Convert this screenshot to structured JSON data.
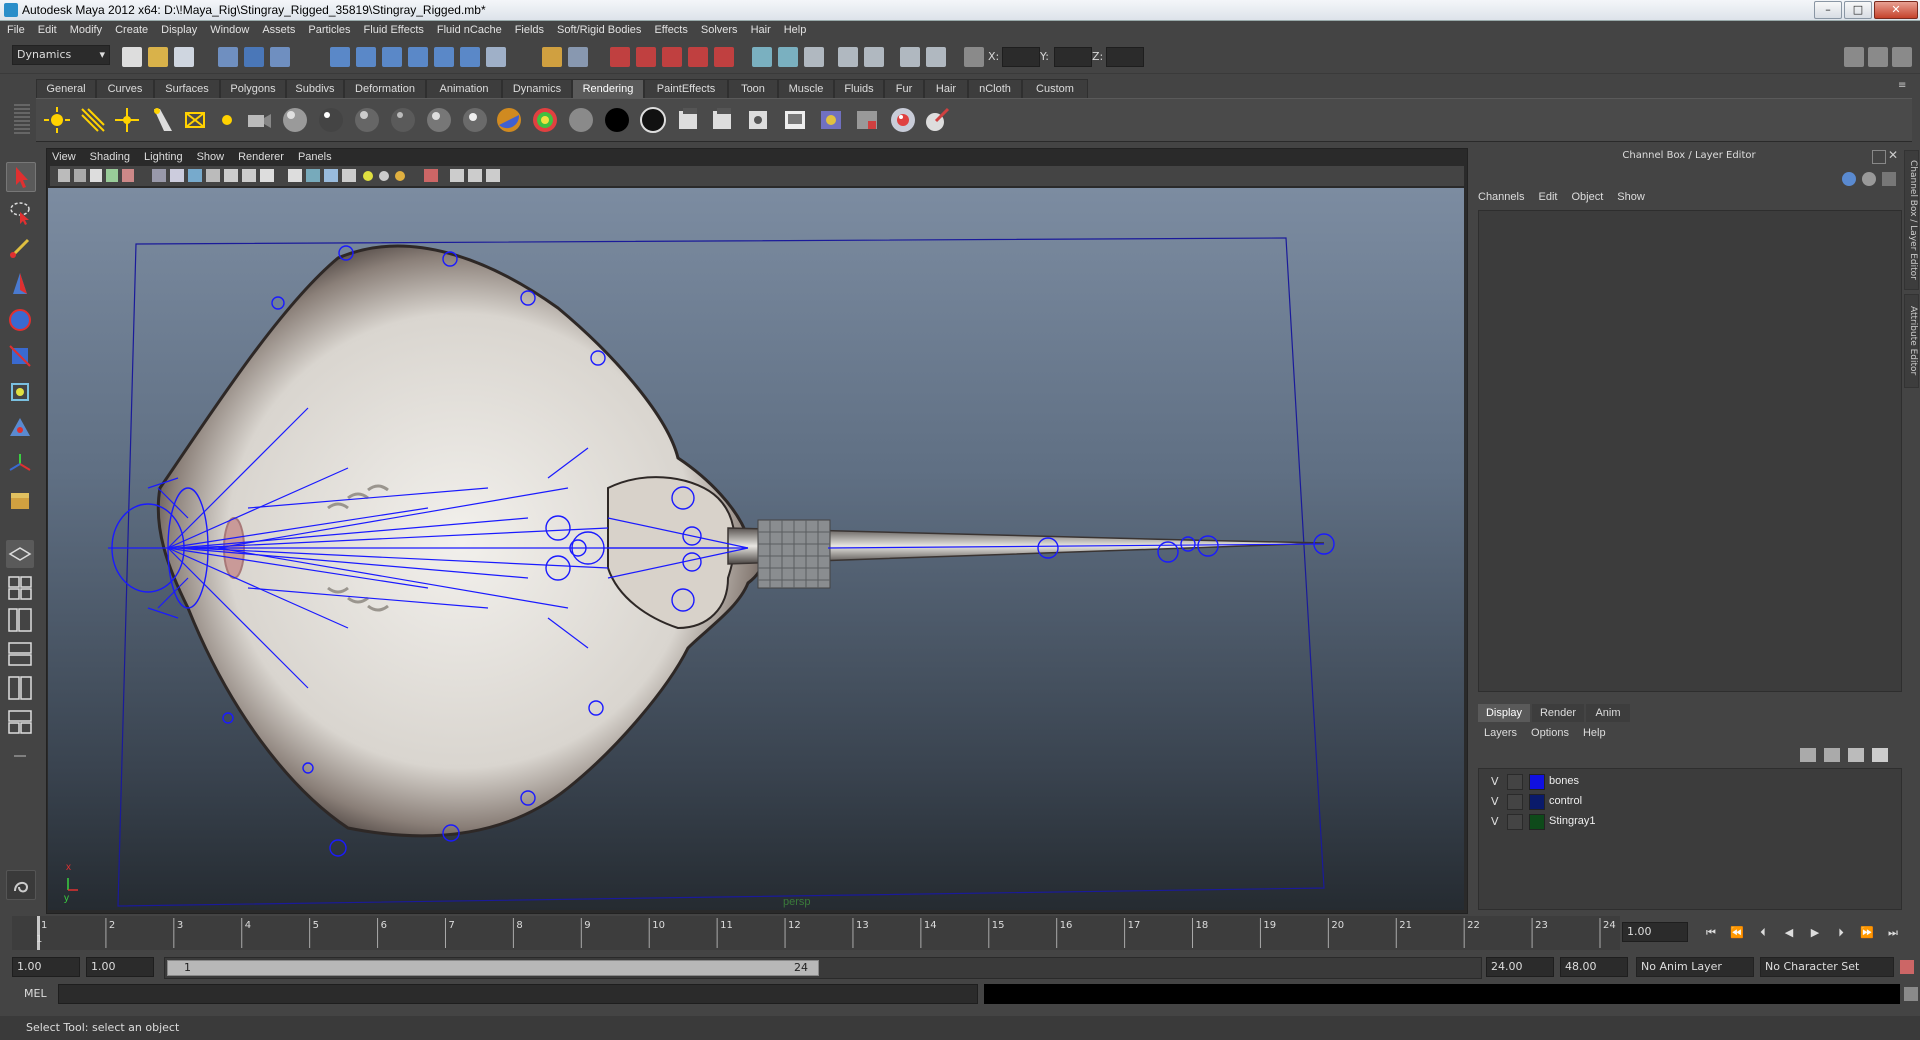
{
  "window": {
    "title": "Autodesk Maya 2012 x64: D:\\!Maya_Rig\\Stingray_Rigged_35819\\Stingray_Rigged.mb*",
    "min_label": "–",
    "max_label": "□",
    "close_label": "✕"
  },
  "menubar": [
    "File",
    "Edit",
    "Modify",
    "Create",
    "Display",
    "Window",
    "Assets",
    "Particles",
    "Fluid Effects",
    "Fluid nCache",
    "Fields",
    "Soft/Rigid Bodies",
    "Effects",
    "Solvers",
    "Hair",
    "Help"
  ],
  "statusline": {
    "mode": "Dynamics",
    "x_label": "X:",
    "y_label": "Y:",
    "z_label": "Z:"
  },
  "shelf_tabs": [
    "General",
    "Curves",
    "Surfaces",
    "Polygons",
    "Subdivs",
    "Deformation",
    "Animation",
    "Dynamics",
    "Rendering",
    "PaintEffects",
    "Toon",
    "Muscle",
    "Fluids",
    "Fur",
    "Hair",
    "nCloth",
    "Custom"
  ],
  "shelf_active": "Rendering",
  "viewport": {
    "menu": [
      "View",
      "Shading",
      "Lighting",
      "Show",
      "Renderer",
      "Panels"
    ],
    "camera_label": "persp",
    "axis_x": "x",
    "axis_y": "y"
  },
  "channel_box": {
    "title": "Channel Box / Layer Editor",
    "menu": [
      "Channels",
      "Edit",
      "Object",
      "Show"
    ]
  },
  "layer_editor": {
    "tabs": [
      "Display",
      "Render",
      "Anim"
    ],
    "active_tab": "Display",
    "menu": [
      "Layers",
      "Options",
      "Help"
    ],
    "layers": [
      {
        "visible": "V",
        "name": "bones",
        "color": "#1010e0"
      },
      {
        "visible": "V",
        "name": "control",
        "color": "#0a1a6a"
      },
      {
        "visible": "V",
        "name": "Stingray1",
        "color": "#0e4a1a"
      }
    ]
  },
  "side_tabs": [
    "Channel Box / Layer Editor",
    "Attribute Editor"
  ],
  "timeline": {
    "ticks": [
      "1",
      "2",
      "3",
      "4",
      "5",
      "6",
      "7",
      "8",
      "9",
      "10",
      "11",
      "12",
      "13",
      "14",
      "15",
      "16",
      "17",
      "18",
      "19",
      "20",
      "21",
      "22",
      "23",
      "24"
    ],
    "current_frame_marker": "1",
    "current_frame": "1.00"
  },
  "range": {
    "start_time": "1.00",
    "playback_start": "1.00",
    "range_start_label": "1",
    "range_end_label": "24",
    "playback_end": "24.00",
    "end_time": "48.00",
    "anim_layer": "No Anim Layer",
    "character_set": "No Character Set"
  },
  "command_line": {
    "label": "MEL",
    "value": ""
  },
  "help_line": "Select Tool: select an object",
  "colors": {
    "accent": "#5a5a5a",
    "bones_wire": "#1a1aff"
  }
}
